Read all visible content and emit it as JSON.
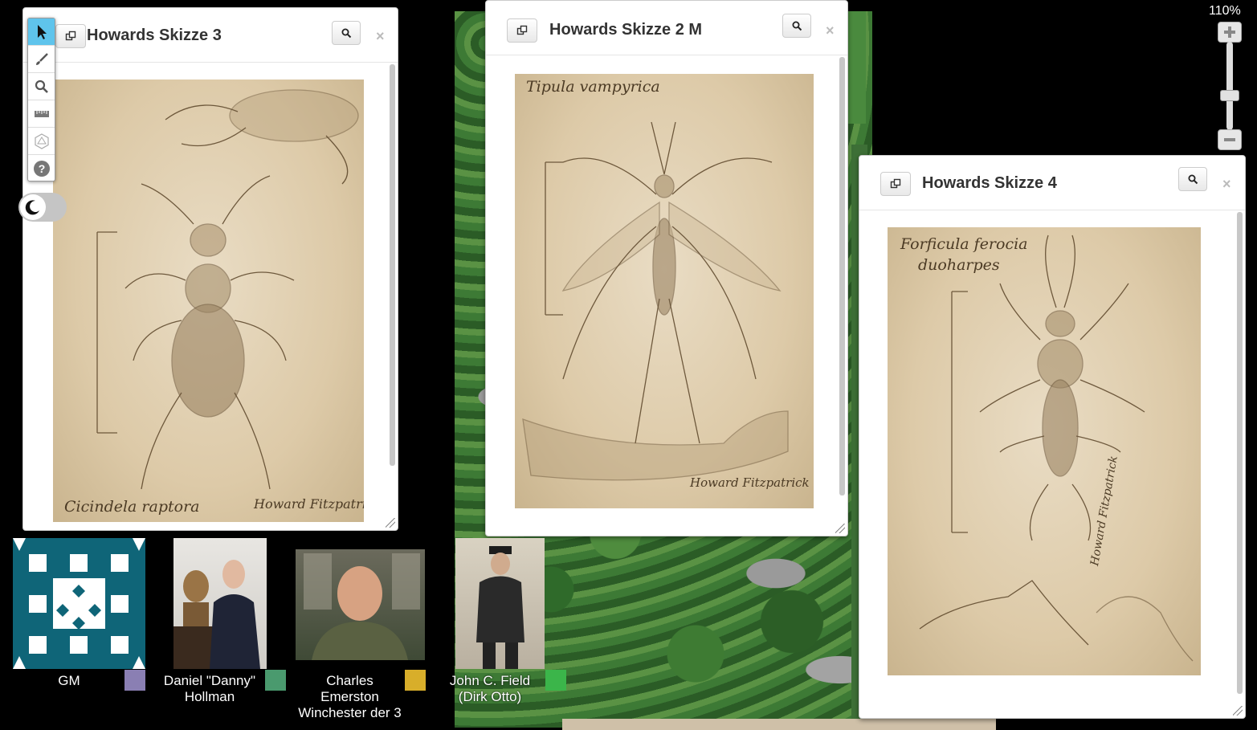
{
  "zoom": {
    "level": "110%"
  },
  "toolbar": {
    "tools": [
      {
        "name": "select-tool",
        "icon": "cursor-icon"
      },
      {
        "name": "draw-tool",
        "icon": "brush-icon"
      },
      {
        "name": "zoom-tool",
        "icon": "magnifier-icon"
      },
      {
        "name": "measure-tool",
        "icon": "ruler-icon"
      },
      {
        "name": "dice-tool",
        "icon": "d20-icon"
      },
      {
        "name": "help-tool",
        "icon": "help-icon"
      }
    ],
    "night_mode_icon": "moon-icon"
  },
  "windows": [
    {
      "title": "Howards Skizze 3",
      "caption": "Cicindela raptora",
      "signature": "Howard Fitzpatrick"
    },
    {
      "title": "Howards Skizze 2 M",
      "caption": "Tipula vampyrica",
      "signature": "Howard Fitzpatrick"
    },
    {
      "title": "Howards Skizze 4",
      "caption": "Forficula ferocia",
      "caption2": "duoharpes",
      "signature": "Howard Fitzpatrick"
    }
  ],
  "players": [
    {
      "name": "GM",
      "color": "#8a7fb3"
    },
    {
      "name": "Daniel \"Danny\" Hollman",
      "color": "#4a9a6e"
    },
    {
      "name": "Charles Emerston Winchester der 3",
      "color": "#d8ae2a"
    },
    {
      "name": "John C. Field (Dirk Otto)",
      "color": "#3bb54a"
    }
  ]
}
